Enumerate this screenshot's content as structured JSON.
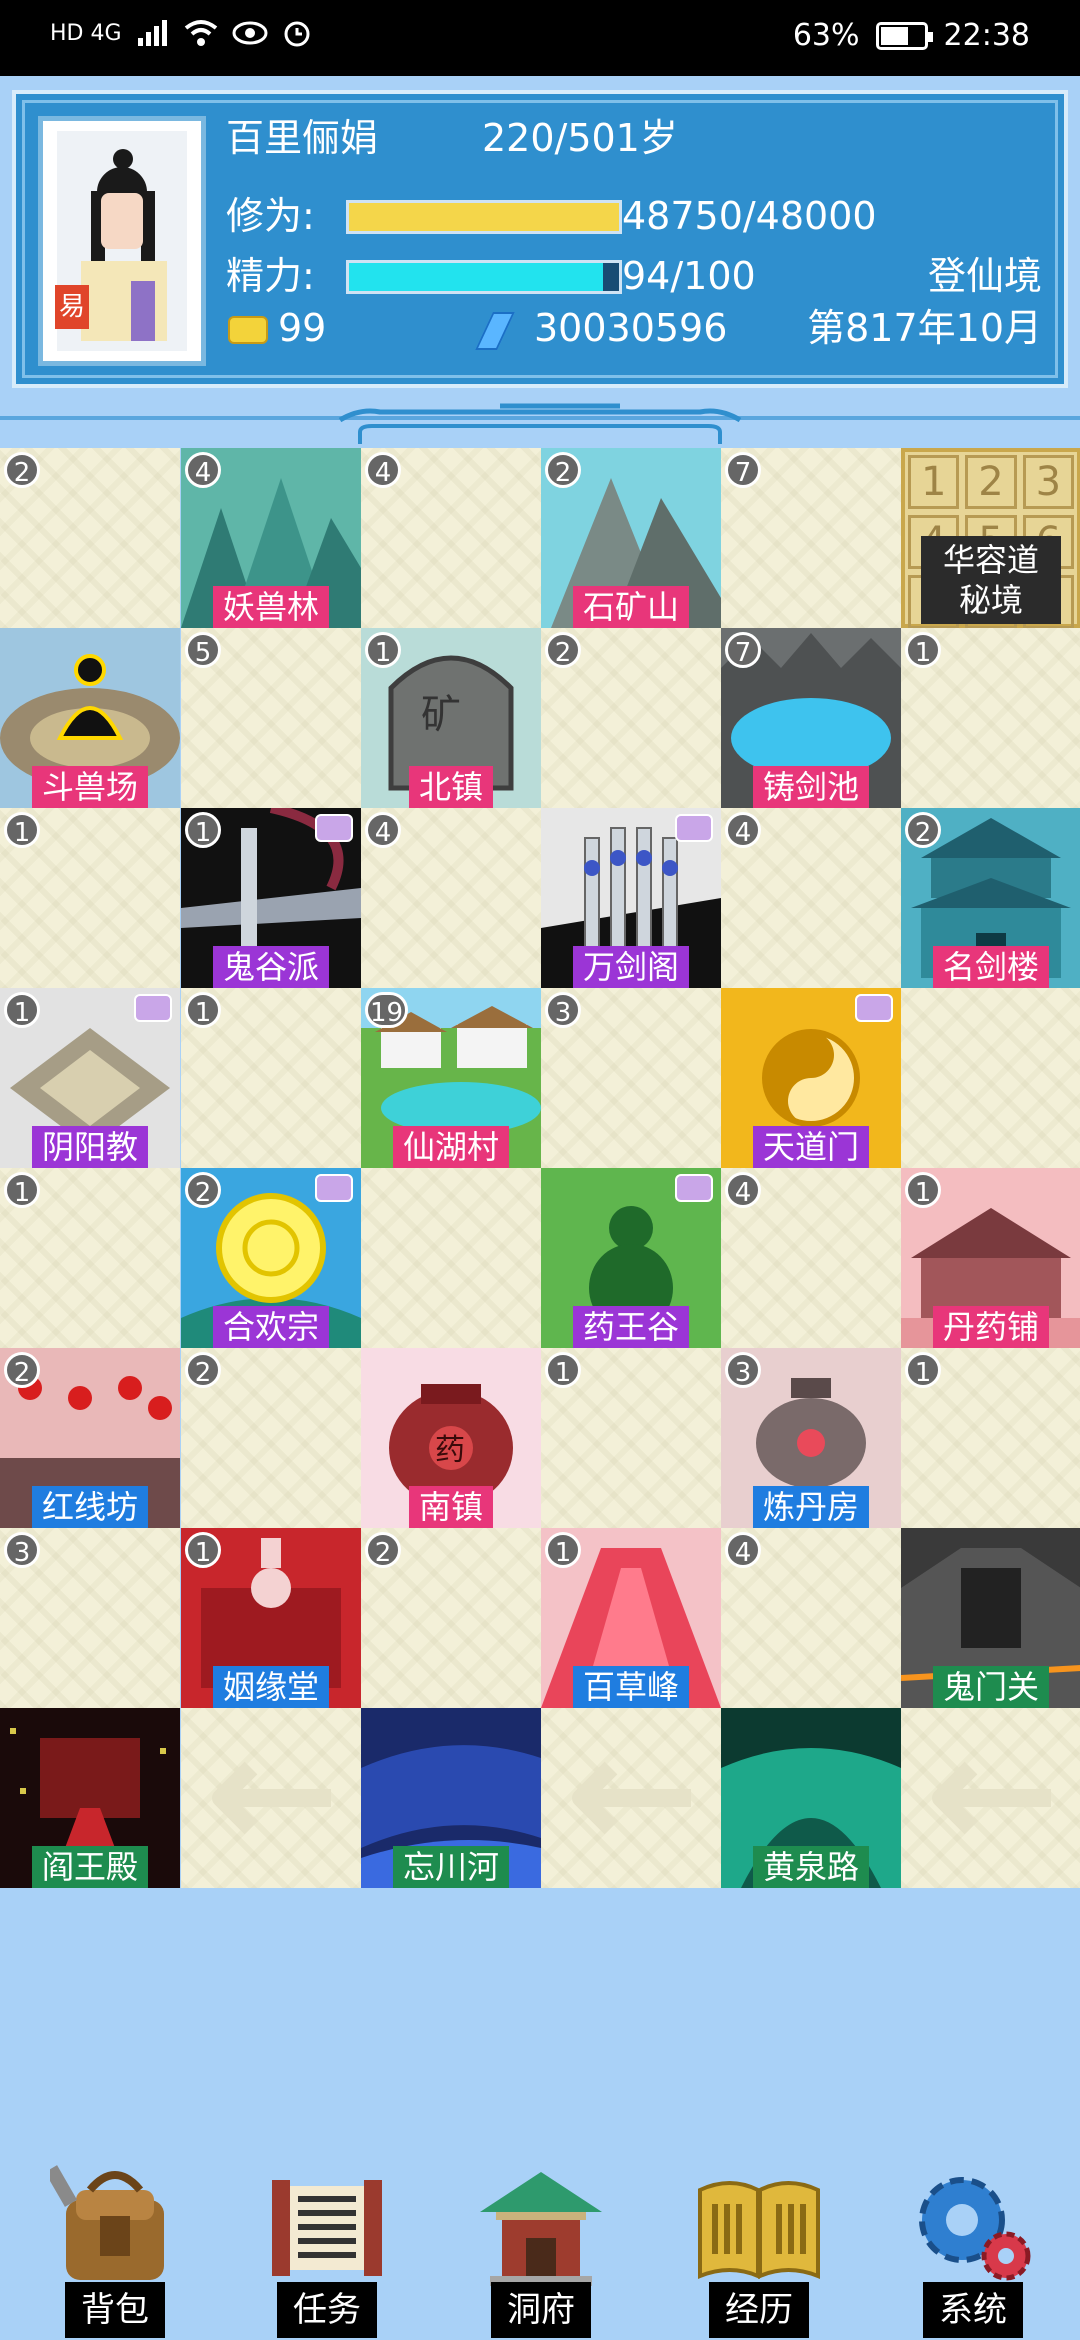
{
  "status_bar": {
    "left_text": "HD 4G",
    "battery": "63%",
    "battery_level": 0.63,
    "time": "22:38"
  },
  "player": {
    "name": "百里俪娟",
    "age": "220/501岁",
    "avatar_badge": "易",
    "cultivation_label": "修为:",
    "cultivation_value": "48750/48000",
    "cultivation_fill": 1.0,
    "energy_label": "精力:",
    "energy_value": "94/100",
    "energy_fill": 0.94,
    "realm": "登仙境",
    "gold": "99",
    "spirit_stones": "30030596",
    "date": "第817年10月"
  },
  "map": {
    "cells": [
      {
        "count": "2",
        "label": "",
        "art": "empty"
      },
      {
        "count": "4",
        "label": "妖兽林",
        "art": "forest",
        "label_color": "#e8367a"
      },
      {
        "count": "4",
        "label": "",
        "art": "empty"
      },
      {
        "count": "2",
        "label": "石矿山",
        "art": "mountain",
        "label_color": "#e8367a"
      },
      {
        "count": "7",
        "label": "",
        "art": "empty"
      },
      {
        "count": "",
        "label": "华容道\n秘境",
        "art": "puzzle"
      },
      {
        "count": "",
        "label": "斗兽场",
        "art": "arena",
        "label_color": "#e8367a"
      },
      {
        "count": "5",
        "label": "",
        "art": "empty"
      },
      {
        "count": "1",
        "label": "北镇",
        "art": "stone",
        "label_color": "#e8367a"
      },
      {
        "count": "2",
        "label": "",
        "art": "empty"
      },
      {
        "count": "7",
        "label": "铸剑池",
        "art": "pool",
        "label_color": "#e8367a"
      },
      {
        "count": "1",
        "label": "",
        "art": "empty"
      },
      {
        "count": "1",
        "label": "",
        "art": "empty"
      },
      {
        "count": "1",
        "label": "鬼谷派",
        "art": "sword",
        "label_color": "#9b35d6",
        "sect": true
      },
      {
        "count": "4",
        "label": "",
        "art": "empty"
      },
      {
        "count": "",
        "label": "万剑阁",
        "art": "swords",
        "label_color": "#9b35d6",
        "sect": true
      },
      {
        "count": "4",
        "label": "",
        "art": "empty"
      },
      {
        "count": "2",
        "label": "名剑楼",
        "art": "tower",
        "label_color": "#e8367a"
      },
      {
        "count": "1",
        "label": "阴阳教",
        "art": "altar",
        "label_color": "#9b35d6",
        "sect": true
      },
      {
        "count": "1",
        "label": "",
        "art": "empty"
      },
      {
        "count": "19",
        "label": "仙湖村",
        "art": "village",
        "label_color": "#e8367a"
      },
      {
        "count": "3",
        "label": "",
        "art": "empty"
      },
      {
        "count": "",
        "label": "天道门",
        "art": "taiji",
        "label_color": "#9b35d6",
        "sect": true
      },
      {
        "count": "",
        "label": "",
        "art": "empty"
      },
      {
        "count": "1",
        "label": "",
        "art": "empty"
      },
      {
        "count": "2",
        "label": "合欢宗",
        "art": "rose",
        "label_color": "#9b35d6",
        "sect": true
      },
      {
        "count": "",
        "label": "",
        "art": "empty"
      },
      {
        "count": "",
        "label": "药王谷",
        "art": "gourd",
        "label_color": "#9b35d6",
        "sect": true
      },
      {
        "count": "4",
        "label": "",
        "art": "empty"
      },
      {
        "count": "1",
        "label": "丹药铺",
        "art": "shop",
        "label_color": "#e8367a"
      },
      {
        "count": "2",
        "label": "红线坊",
        "art": "lanterns",
        "label_color": "#1f7de0"
      },
      {
        "count": "2",
        "label": "",
        "art": "empty"
      },
      {
        "count": "",
        "label": "南镇",
        "art": "jar",
        "label_color": "#e8367a"
      },
      {
        "count": "1",
        "label": "",
        "art": "empty"
      },
      {
        "count": "3",
        "label": "炼丹房",
        "art": "cauldron",
        "label_color": "#1f7de0"
      },
      {
        "count": "1",
        "label": "",
        "art": "empty"
      },
      {
        "count": "3",
        "label": "",
        "art": "empty"
      },
      {
        "count": "1",
        "label": "姻缘堂",
        "art": "wedding",
        "label_color": "#1f7de0"
      },
      {
        "count": "2",
        "label": "",
        "art": "empty"
      },
      {
        "count": "1",
        "label": "百草峰",
        "art": "herbpeak",
        "label_color": "#1f7de0"
      },
      {
        "count": "4",
        "label": "",
        "art": "empty"
      },
      {
        "count": "",
        "label": "鬼门关",
        "art": "ghostgate",
        "label_color": "#1e8c4f"
      },
      {
        "count": "",
        "label": "阎王殿",
        "art": "hall",
        "label_color": "#1e8c4f"
      },
      {
        "count": "",
        "label": "",
        "art": "arrow"
      },
      {
        "count": "",
        "label": "忘川河",
        "art": "river",
        "label_color": "#1e8c4f"
      },
      {
        "count": "",
        "label": "",
        "art": "arrow"
      },
      {
        "count": "",
        "label": "黄泉路",
        "art": "underworld",
        "label_color": "#1e8c4f"
      },
      {
        "count": "",
        "label": "",
        "art": "arrow"
      }
    ]
  },
  "nav": [
    {
      "label": "背包",
      "icon": "backpack-icon"
    },
    {
      "label": "任务",
      "icon": "scroll-icon"
    },
    {
      "label": "洞府",
      "icon": "pavilion-icon"
    },
    {
      "label": "经历",
      "icon": "book-icon"
    },
    {
      "label": "系统",
      "icon": "gear-icon"
    }
  ]
}
